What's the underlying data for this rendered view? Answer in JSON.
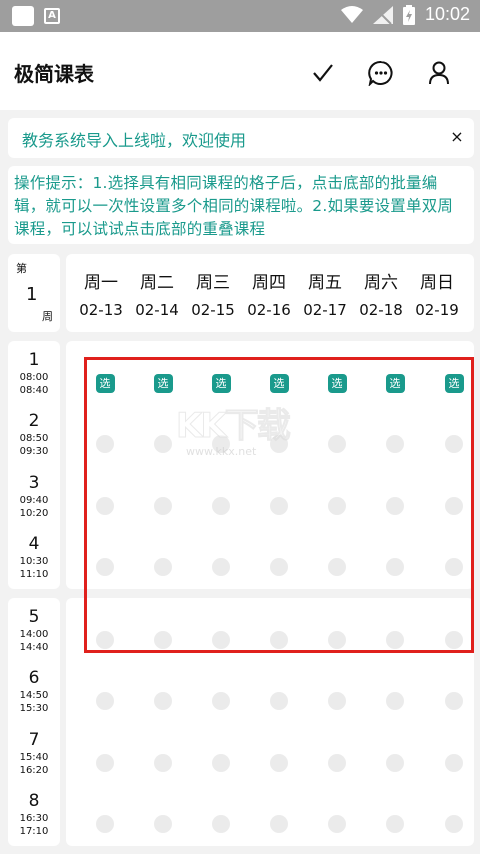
{
  "status_bar": {
    "time": "10:02"
  },
  "app": {
    "title": "极简课表"
  },
  "notice": {
    "text": "教务系统导入上线啦，欢迎使用",
    "close": "×"
  },
  "tip": {
    "text": "操作提示：1.选择具有相同课程的格子后，点击底部的批量编辑，就可以一次性设置多个相同的课程啦。2.如果要设置单双周课程，可以试试点击底部的重叠课程"
  },
  "week": {
    "top": "第",
    "number": "1",
    "bottom": "周"
  },
  "days": [
    {
      "name": "周一",
      "date": "02-13"
    },
    {
      "name": "周二",
      "date": "02-14"
    },
    {
      "name": "周三",
      "date": "02-15"
    },
    {
      "name": "周四",
      "date": "02-16"
    },
    {
      "name": "周五",
      "date": "02-17"
    },
    {
      "name": "周六",
      "date": "02-18"
    },
    {
      "name": "周日",
      "date": "02-19"
    }
  ],
  "periods": [
    {
      "num": "1",
      "start": "08:00",
      "end": "08:40"
    },
    {
      "num": "2",
      "start": "08:50",
      "end": "09:30"
    },
    {
      "num": "3",
      "start": "09:40",
      "end": "10:20"
    },
    {
      "num": "4",
      "start": "10:30",
      "end": "11:10"
    },
    {
      "num": "5",
      "start": "14:00",
      "end": "14:40"
    },
    {
      "num": "6",
      "start": "14:50",
      "end": "15:30"
    },
    {
      "num": "7",
      "start": "15:40",
      "end": "16:20"
    },
    {
      "num": "8",
      "start": "16:30",
      "end": "17:10"
    }
  ],
  "select_label": "选",
  "watermark": {
    "main": "KK下载",
    "sub": "www.kkx.net"
  },
  "colors": {
    "accent": "#1a9a8c",
    "highlight": "#e0201c",
    "dot": "#ebebeb"
  }
}
